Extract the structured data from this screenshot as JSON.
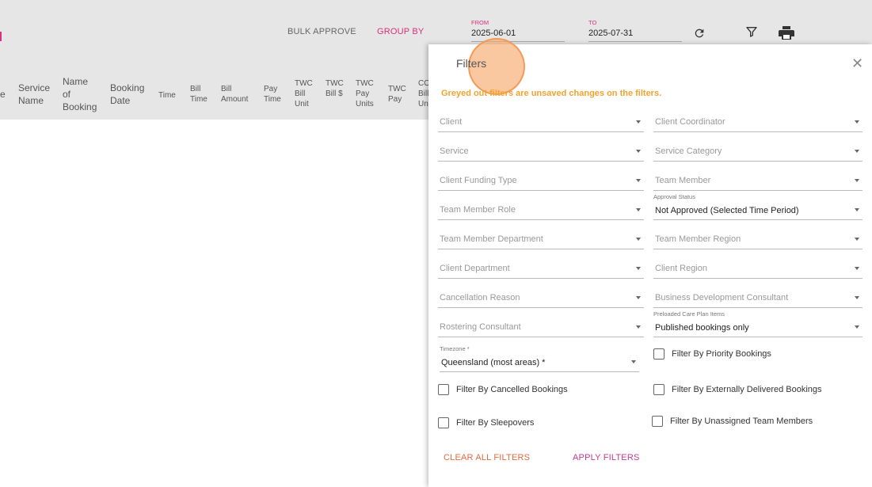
{
  "toolbar": {
    "bulk_approve": "BULK APPROVE",
    "group_by": "GROUP BY",
    "from_label": "FROM",
    "from_value": "2025-06-01",
    "to_label": "TO",
    "to_value": "2025-07-31"
  },
  "table": {
    "headers": [
      {
        "text": "e"
      },
      {
        "text": "Service Name"
      },
      {
        "text": "Name of Booking"
      },
      {
        "text": "Booking Date"
      },
      {
        "text": "Time"
      },
      {
        "text": "Bill Time"
      },
      {
        "text": "Bill Amount"
      },
      {
        "text": "Pay Time"
      },
      {
        "text": "TWC Bill Unit"
      },
      {
        "text": "TWC Bill $"
      },
      {
        "text": "TWC Pay Units"
      },
      {
        "text": "TWC Pay"
      },
      {
        "text": "CO Bill Un"
      }
    ]
  },
  "filters": {
    "title": "Filters",
    "warning": "Greyed out filters are unsaved changes on the filters.",
    "client": "Client",
    "client_coordinator": "Client Coordinator",
    "service": "Service",
    "service_category": "Service Category",
    "client_funding_type": "Client Funding Type",
    "team_member": "Team Member",
    "team_member_role": "Team Member Role",
    "approval_status_label": "Approval Status",
    "approval_status_value": "Not Approved (Selected Time Period)",
    "team_member_department": "Team Member Department",
    "team_member_region": "Team Member Region",
    "client_department": "Client Department",
    "client_region": "Client Region",
    "cancellation_reason": "Cancellation Reason",
    "business_development_consultant": "Business Development Consultant",
    "rostering_consultant": "Rostering Consultant",
    "preloaded_label": "Preloaded Care Plan Items",
    "preloaded_value": "Published bookings only",
    "timezone_label": "Timezone *",
    "timezone_value": "Queensland (most areas) *",
    "cb_priority": "Filter By Priority Bookings",
    "cb_cancelled": "Filter By Cancelled Bookings",
    "cb_external": "Filter By Externally Delivered Bookings",
    "cb_sleepovers": "Filter By Sleepovers",
    "cb_unassigned": "Filter By Unassigned Team Members",
    "clear_all": "CLEAR ALL FILTERS",
    "apply": "APPLY FILTERS"
  }
}
